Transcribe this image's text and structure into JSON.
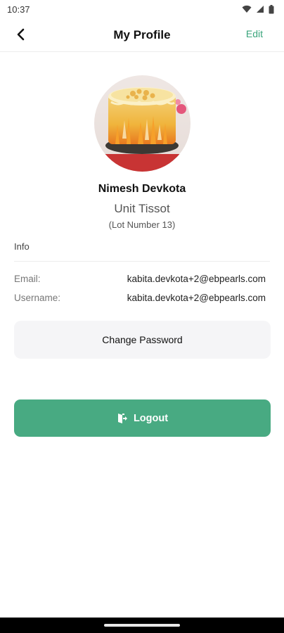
{
  "status_bar": {
    "time": "10:37",
    "icons": [
      "wifi-icon",
      "signal-icon",
      "battery-icon"
    ]
  },
  "header": {
    "title": "My Profile",
    "edit_label": "Edit",
    "back_icon": "chevron-left-icon"
  },
  "profile": {
    "name": "Nimesh Devkota",
    "unit": "Unit Tissot",
    "lot": "(Lot Number 13)"
  },
  "info": {
    "section_label": "Info",
    "email_label": "Email:",
    "email_value": "kabita.devkota+2@ebpearls.com",
    "username_label": "Username:",
    "username_value": "kabita.devkota+2@ebpearls.com"
  },
  "actions": {
    "change_password": "Change Password",
    "logout": "Logout",
    "logout_icon": "logout-icon"
  },
  "colors": {
    "accent": "#48aa82",
    "edit_text": "#3aa57c",
    "secondary_button_bg": "#f5f5f7"
  }
}
